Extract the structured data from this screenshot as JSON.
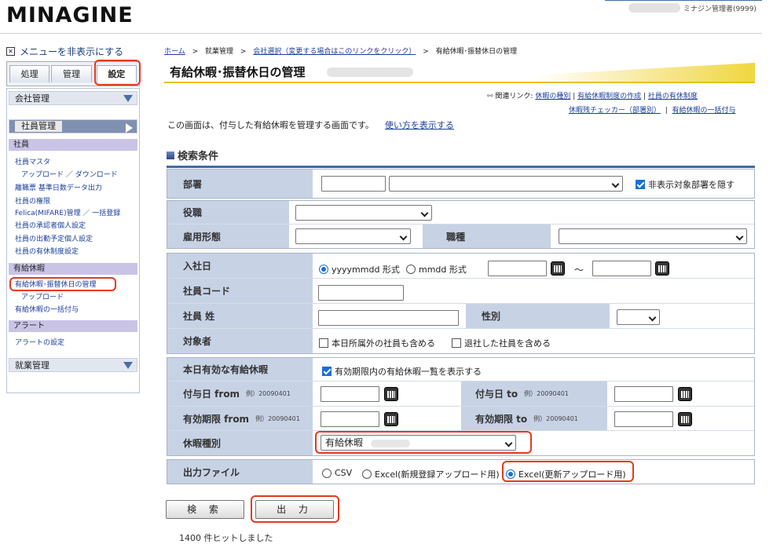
{
  "header": {
    "logo": "MINAGINE",
    "user": "ミナジン管理者(9999)"
  },
  "sidebar": {
    "hide_menu": "メニューを非表示にする",
    "tabs": [
      "処理",
      "管理",
      "設定"
    ],
    "sections": {
      "company": "会社管理",
      "employee": "社員管理",
      "work": "就業管理"
    },
    "groups": {
      "emp": "社員",
      "paid": "有給休暇",
      "alert": "アラート"
    },
    "links": {
      "master": "社員マスタ",
      "updown": "アップロード ／ ダウンロード",
      "leave_data": "離職票 基準日数データ出力",
      "auth": "社員の権限",
      "felica": "Felica(MIFARE)管理 ／ 一括登録",
      "approver": "社員の承認者個人設定",
      "schedule": "社員の出勤予定個人設定",
      "system": "社員の有休制度設定",
      "paid_mgmt": "有給休暇･振替休日の管理",
      "upload": "アップロード",
      "bulk": "有給休暇の一括付与",
      "alert_set": "アラートの設定"
    }
  },
  "breadcrumb": {
    "home": "ホーム",
    "work": "就業管理",
    "company": "会社選択（変更する場合はこのリンクをクリック）",
    "current": "有給休暇･振替休日の管理",
    "sep": ">"
  },
  "page": {
    "title": "有給休暇･振替休日の管理",
    "related_label": "関連リンク:",
    "related": [
      "休暇の種別",
      "有給休暇制度の作成",
      "社員の有休制度",
      "休暇残チェッカー（部署別）",
      "有給休暇の一括付与"
    ],
    "desc": "この画面は、付与した有給休暇を管理する画面です。",
    "howto": "使い方を表示する",
    "search_title": "検索条件"
  },
  "form": {
    "dept": "部署",
    "hide_dept": "非表示対象部署を隠す",
    "position": "役職",
    "employment": "雇用形態",
    "job": "職種",
    "hire": "入社日",
    "fmt1": "yyyymmdd 形式",
    "fmt2": "mmdd 形式",
    "tilde": "～",
    "code": "社員コード",
    "name": "社員 姓",
    "gender": "性別",
    "target": "対象者",
    "t1": "本日所属外の社員も含める",
    "t2": "退社した社員を含める",
    "valid_today": "本日有効な有給休暇",
    "valid_chk": "有効期限内の有給休暇一覧を表示する",
    "grant_from": "付与日 from",
    "grant_to": "付与日 to",
    "exp_from": "有効期限 from",
    "exp_to": "有効期限 to",
    "example": "例）20090401",
    "leave_type": "休暇種別",
    "leave_type_val": "有給休暇",
    "output": "出力ファイル",
    "o1": "CSV",
    "o2": "Excel(新規登録アップロード用)",
    "o3": "Excel(更新アップロード用)"
  },
  "buttons": {
    "search": "検 索",
    "output": "出 力"
  },
  "result": "1400 件ヒットしました"
}
